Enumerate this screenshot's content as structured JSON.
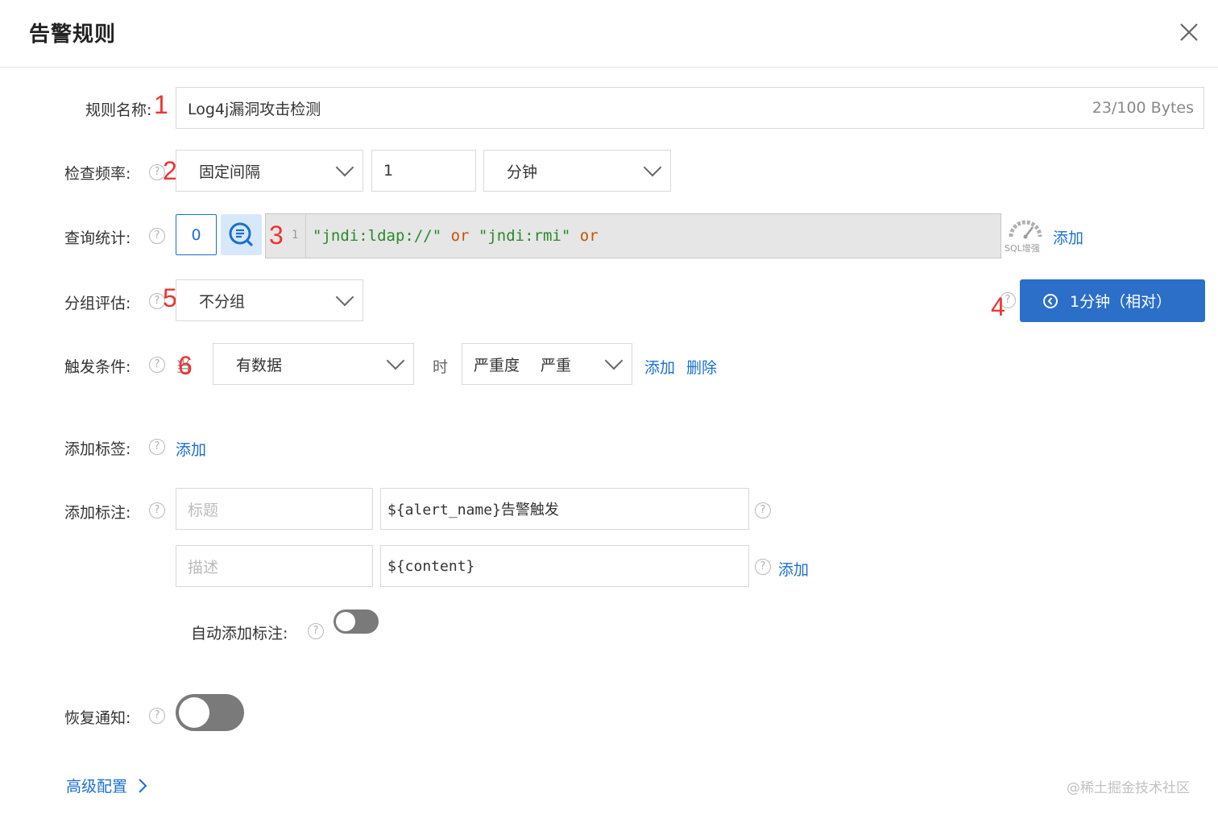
{
  "dialog": {
    "title": "告警规则"
  },
  "marks": {
    "m1": "1",
    "m2": "2",
    "m3": "3",
    "m4": "4",
    "m5": "5",
    "m6": "6"
  },
  "rule_name": {
    "label": "规则名称:",
    "value": "Log4j漏洞攻击检测",
    "counter": "23/100 Bytes"
  },
  "frequency": {
    "label": "检查频率:",
    "type": "固定间隔",
    "interval": "1",
    "unit": "分钟"
  },
  "query": {
    "label": "查询统计:",
    "index": "0",
    "line_no": "1",
    "code": [
      "\"jndi:ldap://\"",
      " or ",
      "\"jndi:rmi\"",
      " or"
    ],
    "sql_enhance": "SQL增强",
    "add": "添加",
    "time_range": "1分钟（相对）"
  },
  "grouping": {
    "label": "分组评估:",
    "value": "不分组"
  },
  "trigger": {
    "label": "触发条件:",
    "prefix": "当",
    "condition": "有数据",
    "when": "时",
    "severity_label": "严重度",
    "severity_value": "严重",
    "add": "添加",
    "delete": "删除"
  },
  "tags": {
    "label": "添加标签:",
    "add": "添加"
  },
  "annotations": {
    "label": "添加标注:",
    "title_placeholder": "标题",
    "title_value": "${alert_name}告警触发",
    "desc_placeholder": "描述",
    "desc_value": "${content}",
    "add": "添加"
  },
  "auto_annotation": {
    "label": "自动添加标注:",
    "enabled": false
  },
  "recovery": {
    "label": "恢复通知:",
    "enabled": false
  },
  "advanced": {
    "label": "高级配置"
  },
  "watermark": "@稀土掘金技术社区",
  "colors": {
    "primary": "#1a6fd1",
    "button": "#2b6fc9",
    "mark": "#e33333"
  }
}
